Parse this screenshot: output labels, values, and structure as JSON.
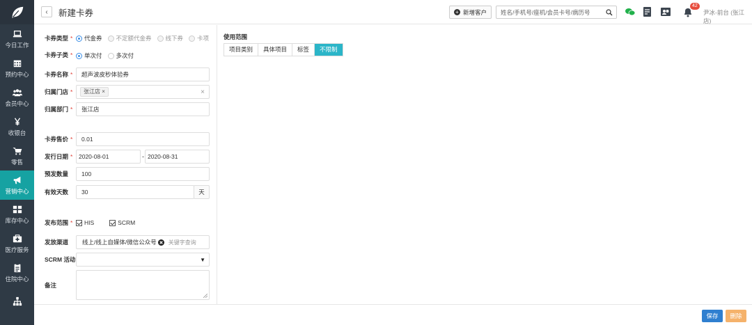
{
  "sidebar": {
    "items": [
      {
        "label": "今日工作",
        "icon": "laptop-icon"
      },
      {
        "label": "预约中心",
        "icon": "calendar-icon"
      },
      {
        "label": "会员中心",
        "icon": "users-icon"
      },
      {
        "label": "收银台",
        "icon": "yen-icon"
      },
      {
        "label": "零售",
        "icon": "cart-icon"
      },
      {
        "label": "营销中心",
        "icon": "megaphone-icon"
      },
      {
        "label": "库存中心",
        "icon": "grid-icon"
      },
      {
        "label": "医疗服务",
        "icon": "medkit-icon"
      },
      {
        "label": "住院中心",
        "icon": "clipboard-icon"
      },
      {
        "label": "",
        "icon": "sitemap-icon"
      }
    ],
    "active_index": 5
  },
  "header": {
    "back": "‹",
    "title": "新建卡券",
    "add_customer": "新增客户",
    "search_placeholder": "姓名/手机号/座机/会员卡号/病历号",
    "notification_count": "42",
    "user": "尹冰-前台 (张江店)"
  },
  "form": {
    "card_type": {
      "label": "卡券类型",
      "options": [
        "代金券",
        "不定额代金券",
        "线下券",
        "卡项"
      ],
      "selected": 0
    },
    "card_subtype": {
      "label": "卡券子类",
      "options": [
        "单次付",
        "多次付"
      ],
      "selected": 0
    },
    "card_name": {
      "label": "卡券名称",
      "value": "超声波皮秒体验券"
    },
    "store": {
      "label": "归属门店",
      "tag": "张江店",
      "tag_close": "×",
      "clear": "×"
    },
    "department": {
      "label": "归属部门",
      "value": "张江店"
    },
    "price": {
      "label": "卡券售价",
      "value": "0.01"
    },
    "issue_date": {
      "label": "发行日期",
      "start": "2020-08-01",
      "sep": "-",
      "end": "2020-08-31"
    },
    "quantity": {
      "label": "预发数量",
      "value": "100"
    },
    "valid_days": {
      "label": "有效天数",
      "value": "30",
      "unit": "天"
    },
    "publish_scope": {
      "label": "发布范围",
      "options": [
        "HIS",
        "SCRM"
      ]
    },
    "channel": {
      "label": "发放渠道",
      "tag": "线上/线上自媒体/微信公众号",
      "placeholder": "关键字查询"
    },
    "scrm_activity": {
      "label": "SCRM 活动",
      "value": "",
      "caret": "▼"
    },
    "remark": {
      "label": "备注",
      "value": ""
    }
  },
  "scope": {
    "title": "使用范围",
    "tabs": [
      "项目类别",
      "具体项目",
      "标签",
      "不限制"
    ],
    "active_tab": 3
  },
  "footer": {
    "save": "保存",
    "delete": "删除"
  },
  "colors": {
    "sidebar_bg": "#2f3a45",
    "active_nav": "#16a2a2",
    "active_tab": "#2bb5c8",
    "save": "#2f7fd0",
    "delete": "#f5b26b",
    "required": "#e0443b",
    "radio_on": "#3a8ee6"
  }
}
